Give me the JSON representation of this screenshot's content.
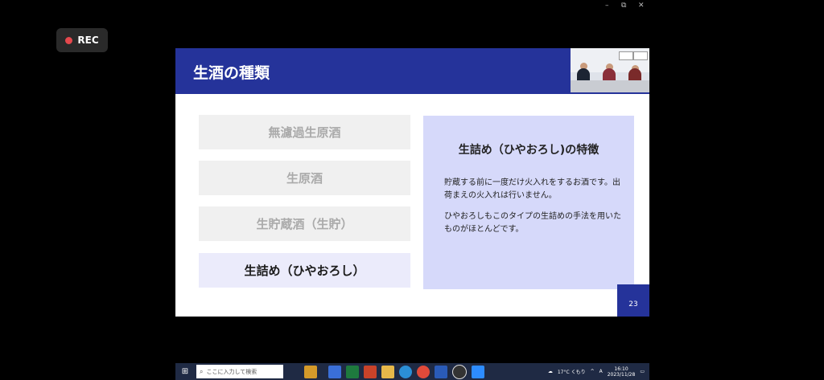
{
  "window": {
    "minimize": "–",
    "restore": "⧉",
    "close": "✕"
  },
  "recording": {
    "label": "REC"
  },
  "slide": {
    "title": "生酒の種類",
    "page_number": "23",
    "types": [
      {
        "label": "無濾過生原酒",
        "state": "dim"
      },
      {
        "label": "生原酒",
        "state": "dim"
      },
      {
        "label": "生貯蔵酒（生貯）",
        "state": "dim"
      },
      {
        "label": "生詰め（ひやおろし）",
        "state": "active"
      }
    ],
    "panel": {
      "title": "生詰め（ひやおろし)の特徴",
      "paragraph1": "貯蔵する前に一度だけ火入れをするお酒です。出荷まえの火入れは行いません。",
      "paragraph2": "ひやおろしもこのタイプの生詰めの手法を用いたものがほとんどです。"
    }
  },
  "taskbar": {
    "search_placeholder": "ここに入力して検索",
    "weather": "17°C くもり",
    "ime": "A",
    "time": "16:10",
    "date": "2023/11/28"
  },
  "colors": {
    "accent": "#25339a",
    "panel": "#d6d9fa",
    "rec": "#e5484d"
  }
}
